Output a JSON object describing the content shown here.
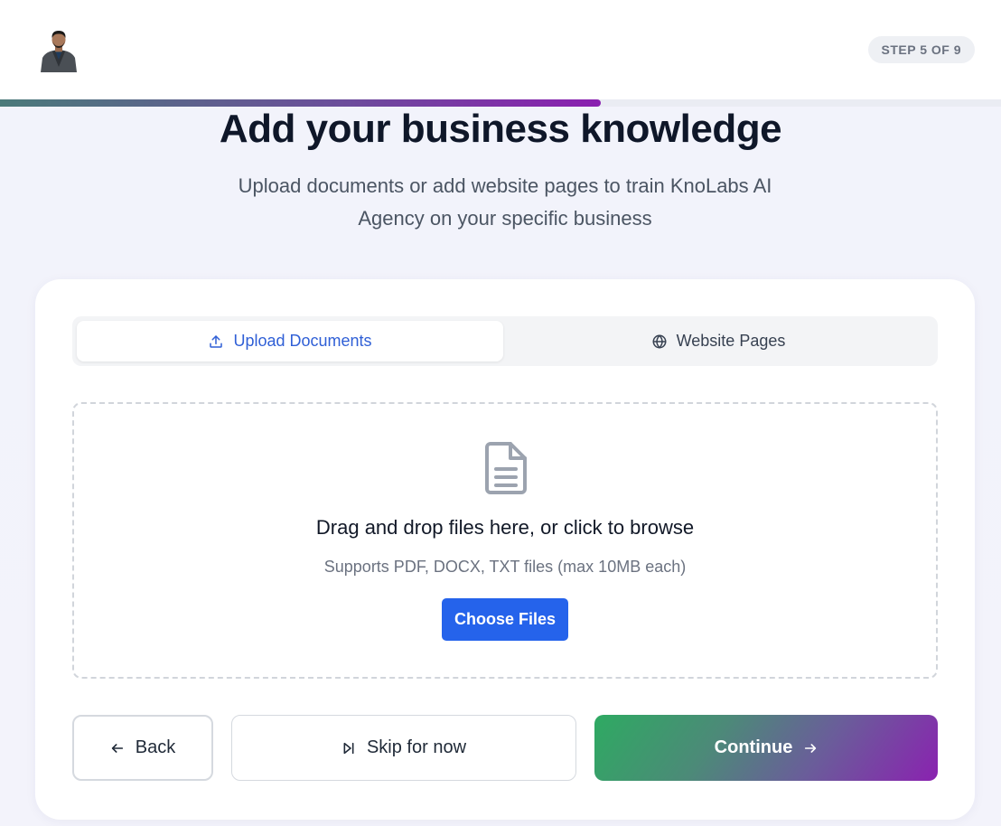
{
  "header": {
    "step_label": "STEP 5 OF 9"
  },
  "progress": {
    "current_step": 5,
    "total_steps": 9,
    "fraction": 0.6
  },
  "heading": {
    "title": "Add your business knowledge",
    "subtitle": "Upload documents or add website pages to train KnoLabs AI Agency on your specific business"
  },
  "tabs": [
    {
      "label": "Upload Documents",
      "icon": "upload-icon",
      "active": true
    },
    {
      "label": "Website Pages",
      "icon": "globe-icon",
      "active": false
    }
  ],
  "dropzone": {
    "icon": "document-icon",
    "title": "Drag and drop files here, or click to browse",
    "subtitle": "Supports PDF, DOCX, TXT files (max 10MB each)",
    "button_label": "Choose Files"
  },
  "footer": {
    "back_label": "Back",
    "skip_label": "Skip for now",
    "continue_label": "Continue"
  },
  "colors": {
    "accent_blue": "#2563eb",
    "tab_active_text": "#2f5fd6",
    "title_text": "#0f1729",
    "continue_gradient_start": "#2eaa62",
    "continue_gradient_end": "#8a22b0"
  }
}
